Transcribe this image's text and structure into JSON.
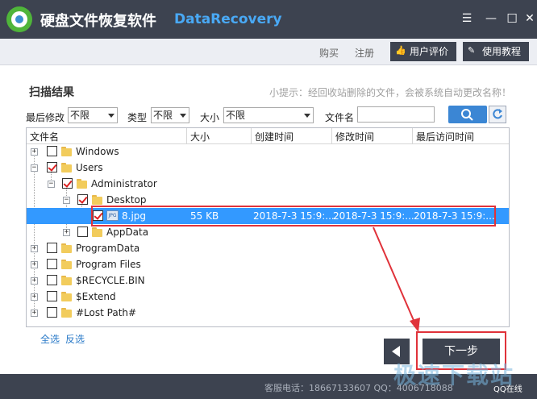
{
  "app": {
    "title": "硬盘文件恢复软件",
    "subtitle": "DataRecovery"
  },
  "window_controls": {
    "menu": "☰",
    "minimize": "—",
    "maximize": "☐",
    "close": "✕"
  },
  "menubar": {
    "buy": "购买",
    "register": "注册",
    "user_review": "用户评价",
    "tutorial": "使用教程"
  },
  "section_title": "扫描结果",
  "hint": "小提示：经回收站删除的文件，会被系统自动更改名称！",
  "filters": {
    "last_modified_label": "最后修改",
    "last_modified_value": "不限",
    "type_label": "类型",
    "type_value": "不限",
    "size_label": "大小",
    "size_value": "不限",
    "filename_label": "文件名",
    "filename_value": ""
  },
  "table": {
    "headers": [
      "文件名",
      "大小",
      "创建时间",
      "修改时间",
      "最后访问时间"
    ],
    "rows": [
      {
        "name": "Windows",
        "size": "",
        "created": "",
        "modified": "",
        "accessed": ""
      },
      {
        "name": "Users",
        "size": "",
        "created": "",
        "modified": "",
        "accessed": ""
      },
      {
        "name": "Administrator",
        "size": "",
        "created": "",
        "modified": "",
        "accessed": ""
      },
      {
        "name": "Desktop",
        "size": "",
        "created": "",
        "modified": "",
        "accessed": ""
      },
      {
        "name": "8.jpg",
        "size": "55 KB",
        "created": "2018-7-3 15:9:...",
        "modified": "2018-7-3 15:9:...",
        "accessed": "2018-7-3 15:9:..."
      },
      {
        "name": "AppData",
        "size": "",
        "created": "",
        "modified": "",
        "accessed": ""
      },
      {
        "name": "ProgramData",
        "size": "",
        "created": "",
        "modified": "",
        "accessed": ""
      },
      {
        "name": "Program Files",
        "size": "",
        "created": "",
        "modified": "",
        "accessed": ""
      },
      {
        "name": "$RECYCLE.BIN",
        "size": "",
        "created": "",
        "modified": "",
        "accessed": ""
      },
      {
        "name": "$Extend",
        "size": "",
        "created": "",
        "modified": "",
        "accessed": ""
      },
      {
        "name": "#Lost Path#",
        "size": "",
        "created": "",
        "modified": "",
        "accessed": ""
      }
    ],
    "jpg_icon_text": "JPG"
  },
  "select_all": "全选",
  "invert_select": "反选",
  "next_button": "下一步",
  "status": "客服电话：18667133607 QQ：4006718088",
  "watermark": {
    "main": "极速下载站",
    "small": "QQ在线"
  },
  "colors": {
    "titlebar": "#3d4350",
    "selection": "#3399ff",
    "highlight_border": "#e0323a",
    "accent_text": "#49a9f5",
    "brand_green": "#4fb53a"
  }
}
